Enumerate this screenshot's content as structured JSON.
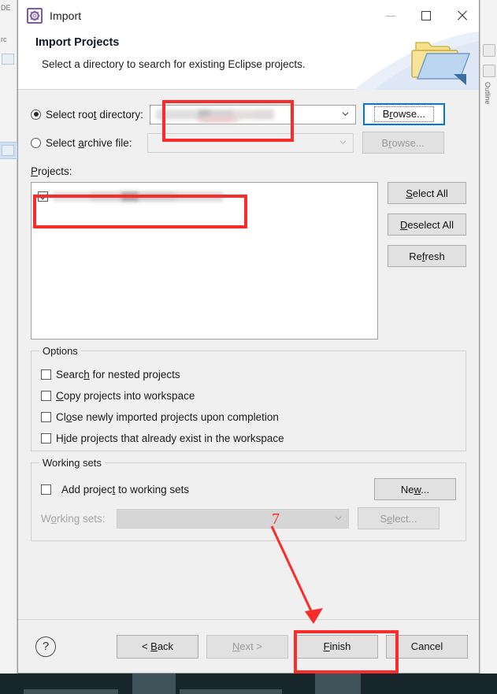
{
  "window": {
    "title": "Import",
    "icon": "import-gear-icon",
    "controls": {
      "minimize": "minimize-icon",
      "maximize": "maximize-icon",
      "close": "close-icon"
    }
  },
  "header": {
    "title": "Import Projects",
    "description": "Select a directory to search for existing Eclipse projects.",
    "icon": "folder-import-icon"
  },
  "source": {
    "root_directory": {
      "label": "Select root directory:",
      "label_pre": "Select roo",
      "label_mnemonic": "t",
      "label_post": " directory:",
      "selected": true,
      "value": "",
      "value_redacted": true,
      "browse_label": "Browse...",
      "browse_mnemonic": "r",
      "browse_focused": true
    },
    "archive_file": {
      "label": "Select archive file:",
      "label_pre": "Select ",
      "label_mnemonic": "a",
      "label_post": "rchive file:",
      "selected": false,
      "value": "",
      "placeholder": "",
      "browse_label": "Browse...",
      "browse_mnemonic": "r",
      "disabled": true
    }
  },
  "projects": {
    "label": "Projects:",
    "label_mnemonic": "P",
    "label_post": "rojects:",
    "items": [
      {
        "checked": true,
        "name": "",
        "redacted": true
      }
    ],
    "buttons": [
      {
        "label": "Select All",
        "mnemonic": "S",
        "pre": "",
        "post": "elect All"
      },
      {
        "label": "Deselect All",
        "mnemonic": "D",
        "pre": "",
        "post": "eselect All"
      },
      {
        "label": "Refresh",
        "mnemonic": "f",
        "pre": "Re",
        "post": "resh"
      }
    ]
  },
  "options": {
    "title": "Options",
    "items": [
      {
        "label": "Search for nested projects",
        "checked": false,
        "pre": "Searc",
        "mnemonic": "h",
        "post": " for nested projects"
      },
      {
        "label": "Copy projects into workspace",
        "checked": false,
        "pre": "",
        "mnemonic": "C",
        "post": "opy projects into workspace"
      },
      {
        "label": "Close newly imported projects upon completion",
        "checked": false,
        "pre": "Cl",
        "mnemonic": "o",
        "post": "se newly imported projects upon completion"
      },
      {
        "label": "Hide projects that already exist in the workspace",
        "checked": false,
        "pre": "H",
        "mnemonic": "i",
        "post": "de projects that already exist in the workspace"
      }
    ]
  },
  "working_sets": {
    "title": "Working sets",
    "add_checkbox": {
      "label": "Add project to working sets",
      "checked": false,
      "pre": "Add projec",
      "mnemonic": "t",
      "post": " to working sets"
    },
    "new_button": {
      "label": "New...",
      "pre": "Ne",
      "mnemonic": "w",
      "post": "..."
    },
    "combo_label": "Working sets:",
    "combo_label_pre": "W",
    "combo_label_mnemonic": "o",
    "combo_label_post": "rking sets:",
    "combo_value": "",
    "combo_disabled": true,
    "select_button": {
      "label": "Select...",
      "pre": "S",
      "mnemonic": "e",
      "post": "lect...",
      "disabled": true
    }
  },
  "footer": {
    "help": "?",
    "buttons": [
      {
        "label": "< Back",
        "pre": "< ",
        "mnemonic": "B",
        "post": "ack",
        "disabled": false
      },
      {
        "label": "Next >",
        "pre": "",
        "mnemonic": "N",
        "post": "ext >",
        "disabled": true
      },
      {
        "label": "Finish",
        "pre": "",
        "mnemonic": "F",
        "post": "inish",
        "disabled": false
      },
      {
        "label": "Cancel",
        "pre": "Cancel",
        "mnemonic": "",
        "post": "",
        "disabled": false
      }
    ]
  },
  "annotations": {
    "color": "#fb2b2b",
    "step_number": "7",
    "rects": [
      {
        "name": "root-directory-combo-highlight"
      },
      {
        "name": "project-item-highlight"
      },
      {
        "name": "finish-button-highlight"
      }
    ]
  }
}
